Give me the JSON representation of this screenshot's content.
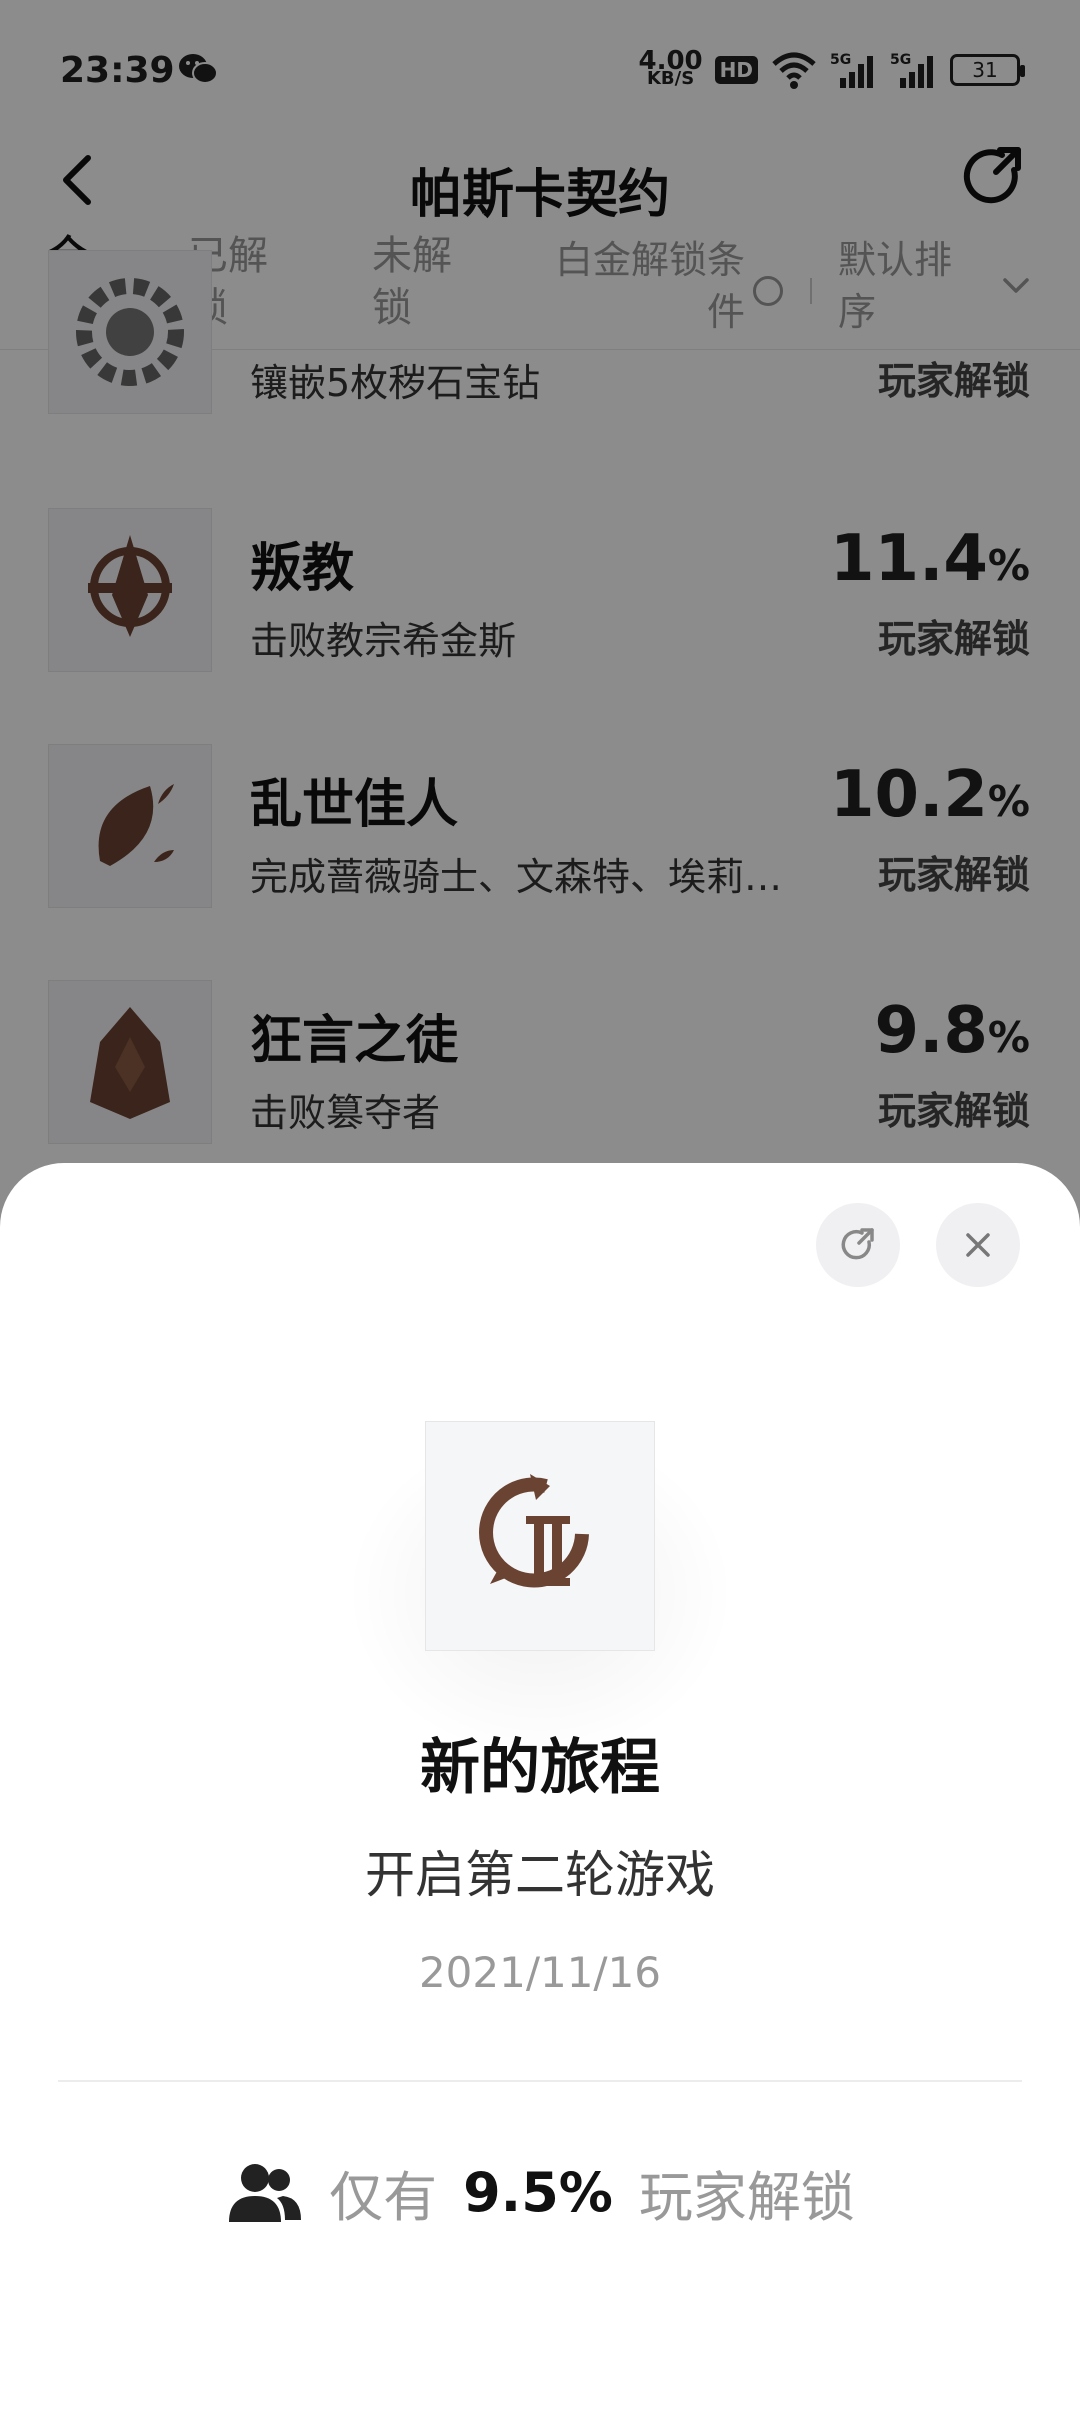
{
  "status_bar": {
    "time": "23:39",
    "net_speed_value": "4.00",
    "net_speed_unit": "KB/S",
    "hd_badge": "HD",
    "battery": "31",
    "icons": [
      "wechat-icon",
      "wifi-icon",
      "signal-5g-icon",
      "signal-5g-icon",
      "battery-icon"
    ]
  },
  "header": {
    "title": "帕斯卡契约"
  },
  "tabs": {
    "all": "全部",
    "unlocked": "已解锁",
    "locked": "未解锁",
    "platinum": "白金解锁条件",
    "sort": "默认排序"
  },
  "list": {
    "items": [
      {
        "name": "",
        "desc": "镶嵌5枚秽石宝钻",
        "pct": "",
        "pct_unit": "",
        "unlock": "玩家解锁"
      },
      {
        "name": "叛教",
        "desc": "击败教宗希金斯",
        "pct": "11.4",
        "pct_unit": "%",
        "unlock": "玩家解锁"
      },
      {
        "name": "乱世佳人",
        "desc": "完成蔷薇骑士、文森特、埃莉…",
        "pct": "10.2",
        "pct_unit": "%",
        "unlock": "玩家解锁"
      },
      {
        "name": "狂言之徒",
        "desc": "击败篡夺者",
        "pct": "9.8",
        "pct_unit": "%",
        "unlock": "玩家解锁"
      }
    ]
  },
  "sheet": {
    "title": "新的旅程",
    "desc": "开启第二轮游戏",
    "date": "2021/11/16",
    "rarity_prefix": "仅有",
    "rarity_value": "9.5%",
    "rarity_suffix": "玩家解锁"
  },
  "colors": {
    "overlay": "rgba(0,0,0,0.45)",
    "badge_brown": "#6b4332",
    "text_primary": "#111111",
    "text_muted": "#999999"
  }
}
